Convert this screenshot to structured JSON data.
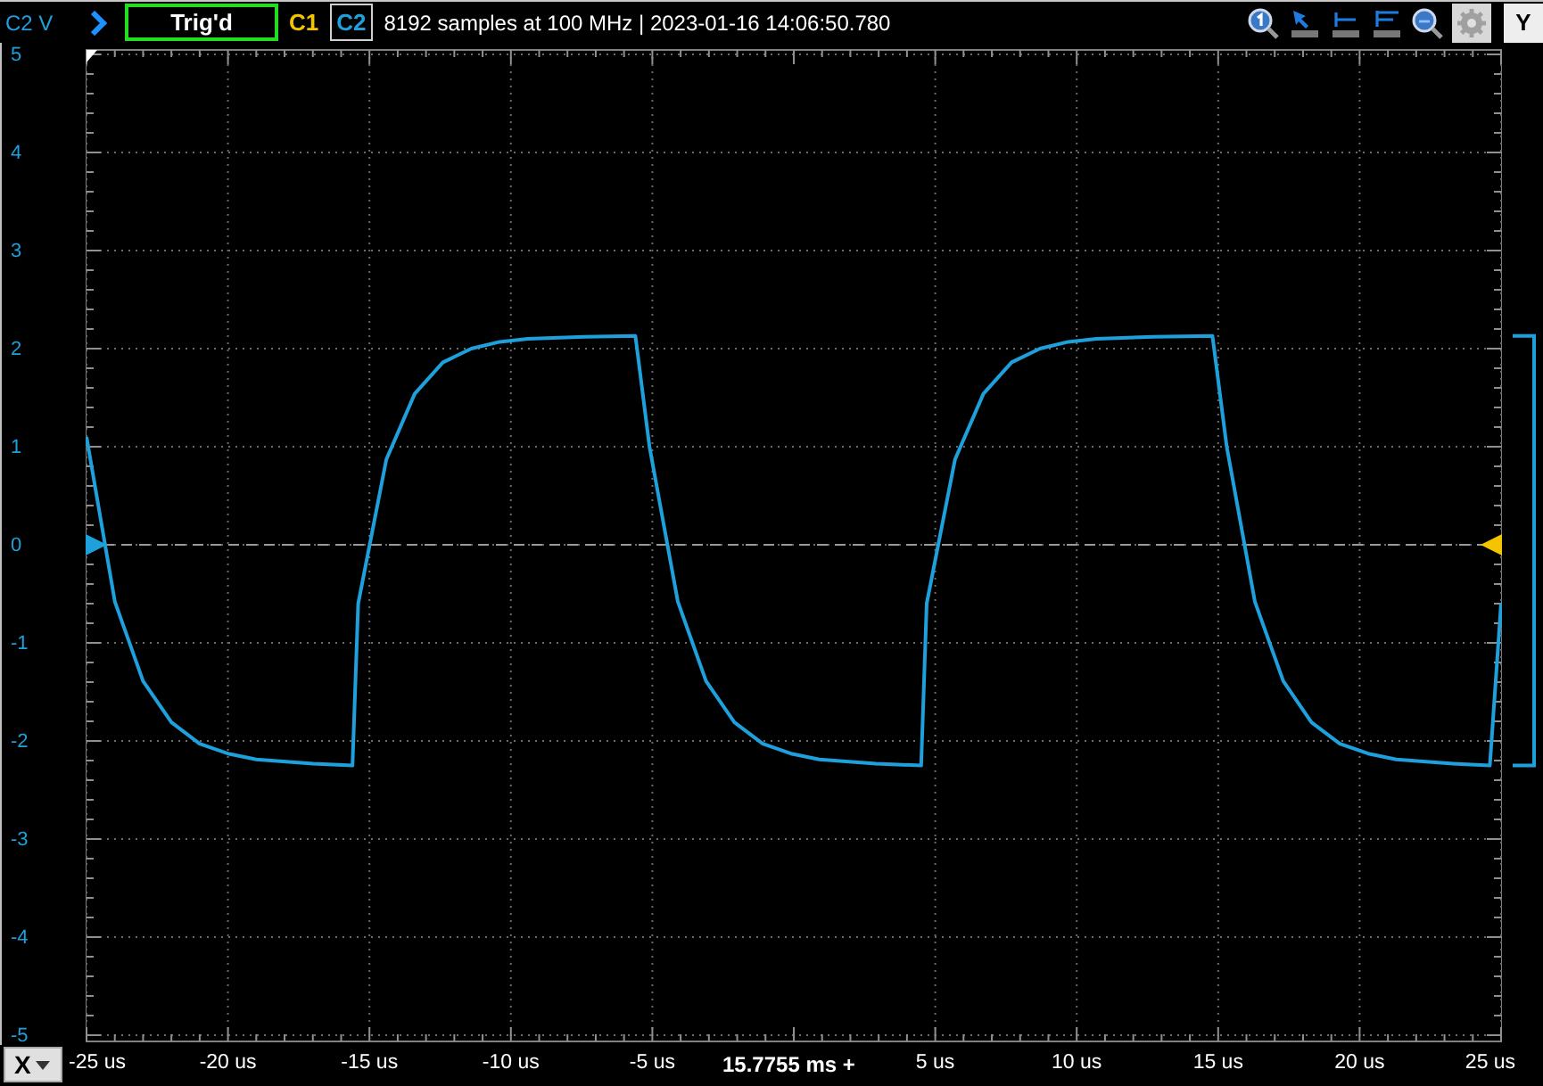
{
  "top_bar": {
    "axis_unit": "C2 V",
    "status": "Trig'd",
    "info": "8192 samples at 100 MHz | 2023-01-16 14:06:50.780"
  },
  "channels": [
    {
      "label": "C1",
      "color": "#f5c400",
      "selected": false
    },
    {
      "label": "C2",
      "color": "#1ea0dc",
      "selected": true
    }
  ],
  "toolbar": [
    {
      "kind": "zoom-in"
    },
    {
      "kind": "cursor"
    },
    {
      "kind": "single-marker"
    },
    {
      "kind": "double-marker"
    },
    {
      "kind": "zoom"
    },
    {
      "kind": "settings"
    }
  ],
  "y_button": "Y",
  "x_button": "X",
  "time_offset": "15.7755 ms +",
  "markers": [
    {
      "kind": "offset",
      "color": "#1ea0dc"
    },
    {
      "kind": "trigger-level",
      "color": "#f5c400"
    },
    {
      "kind": "trigger-position",
      "color": "#ffffff"
    }
  ],
  "chart_data": {
    "type": "line",
    "xlim": [
      -25,
      25
    ],
    "ylim": [
      -5,
      5
    ],
    "grid": true,
    "ref_lines": [
      {
        "axis": "y",
        "value": 0
      }
    ],
    "xticks": [
      {
        "value": -25,
        "label": "-25 us"
      },
      {
        "value": -20,
        "label": "-20 us"
      },
      {
        "value": -15,
        "label": "-15 us"
      },
      {
        "value": -10,
        "label": "-10 us"
      },
      {
        "value": -5,
        "label": "-5 us"
      },
      {
        "value": 5,
        "label": "5 us"
      },
      {
        "value": 10,
        "label": "10 us"
      },
      {
        "value": 15,
        "label": "15 us"
      },
      {
        "value": 20,
        "label": "20 us"
      },
      {
        "value": 25,
        "label": "25 us"
      }
    ],
    "yticks": [
      5,
      4,
      3,
      2,
      1,
      0,
      -1,
      -2,
      -3,
      -4,
      -5
    ],
    "x": [
      -25,
      -24,
      -23,
      -22,
      -21,
      -20,
      -19,
      -17,
      -15.6,
      -15.4,
      -14.4,
      -13.4,
      -12.4,
      -11.4,
      -10.4,
      -9.4,
      -7.4,
      -5.6,
      -5.1,
      -4.1,
      -3.1,
      -2.1,
      -1.1,
      -0.1,
      0.9,
      2.9,
      4.5,
      4.7,
      5.7,
      6.7,
      7.7,
      8.7,
      9.7,
      10.7,
      12.7,
      14.8,
      15.3,
      16.3,
      17.3,
      18.3,
      19.3,
      20.3,
      21.3,
      23.3,
      24.6,
      25
    ],
    "series": [
      {
        "color": "#1ea0dc",
        "values": [
          1.1,
          -0.58,
          -1.39,
          -1.81,
          -2.03,
          -2.13,
          -2.19,
          -2.23,
          -2.25,
          -0.6,
          0.87,
          1.54,
          1.86,
          2.0,
          2.07,
          2.1,
          2.12,
          2.13,
          1.0,
          -0.58,
          -1.39,
          -1.81,
          -2.03,
          -2.13,
          -2.19,
          -2.23,
          -2.25,
          -0.6,
          0.87,
          1.54,
          1.86,
          2.0,
          2.07,
          2.1,
          2.12,
          2.13,
          1.0,
          -0.58,
          -1.39,
          -1.81,
          -2.03,
          -2.13,
          -2.19,
          -2.23,
          -2.25,
          -0.6
        ]
      }
    ]
  }
}
